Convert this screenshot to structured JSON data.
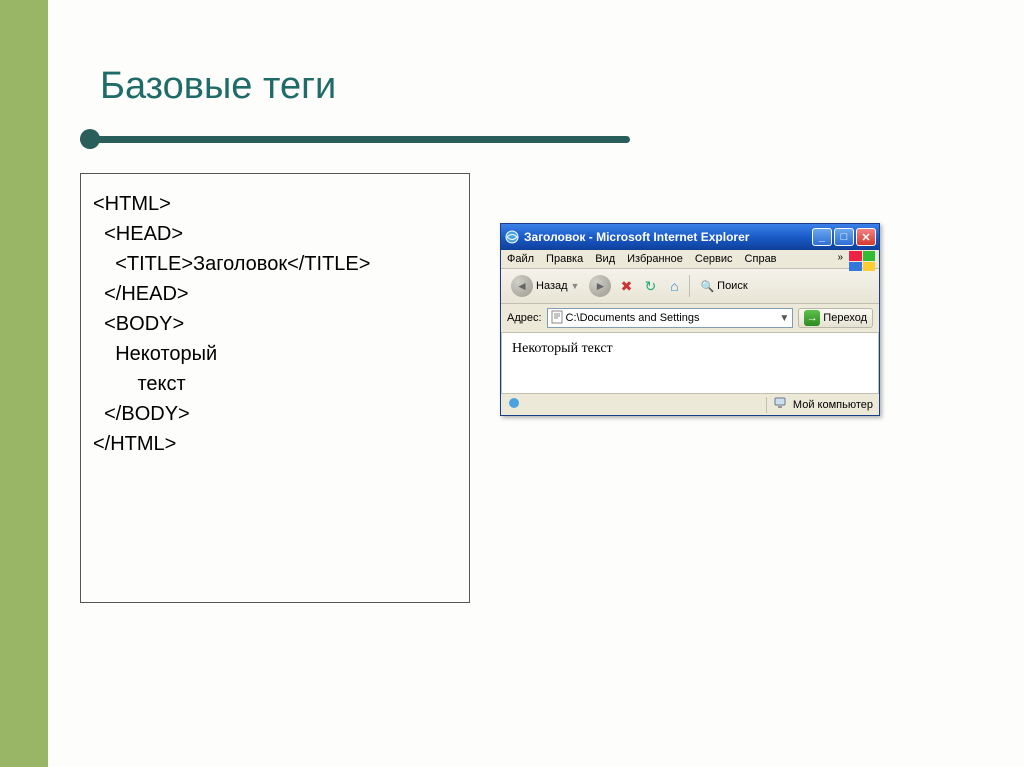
{
  "slide": {
    "title": "Базовые теги",
    "code": "<HTML>\n  <HEAD>\n    <TITLE>Заголовок</TITLE>\n  </HEAD>\n  <BODY>\n    Некоторый\n        текст\n  </BODY>\n</HTML>"
  },
  "browser": {
    "titlebar": "Заголовок - Microsoft Internet Explorer",
    "menu": {
      "file": "Файл",
      "edit": "Правка",
      "view": "Вид",
      "favorites": "Избранное",
      "tools": "Сервис",
      "help": "Справ"
    },
    "toolbar": {
      "back": "Назад",
      "search": "Поиск"
    },
    "addressbar": {
      "label": "Адрес:",
      "path": "C:\\Documents and Settings",
      "go": "Переход"
    },
    "body": "Некоторый текст",
    "status": {
      "mycomputer": "Мой компьютер"
    }
  }
}
